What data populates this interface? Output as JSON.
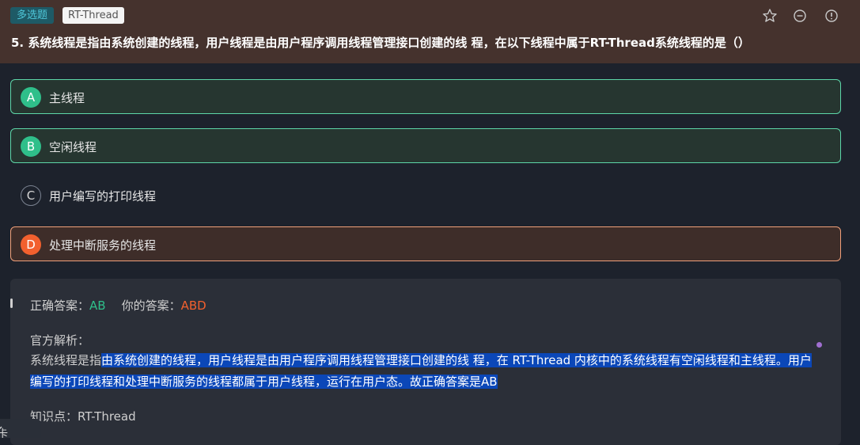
{
  "header": {
    "type_tag": "多选题",
    "topic_tag": "RT-Thread",
    "question": "5. 系统线程是指由系统创建的线程，用户线程是由用户程序调用线程管理接口创建的线 程，在以下线程中属于RT-Thread系统线程的是（）",
    "icons": [
      "star-icon",
      "minus-circle-icon",
      "info-icon"
    ]
  },
  "options": [
    {
      "letter": "A",
      "text": "主线程",
      "state": "correct"
    },
    {
      "letter": "B",
      "text": "空闲线程",
      "state": "correct"
    },
    {
      "letter": "C",
      "text": "用户编写的打印线程",
      "state": "plain"
    },
    {
      "letter": "D",
      "text": "处理中断服务的线程",
      "state": "wrong"
    }
  ],
  "result": {
    "correct_label": "正确答案：",
    "correct_value": "AB",
    "yours_label": "你的答案：",
    "yours_value": "ABD"
  },
  "explanation": {
    "title": "官方解析：",
    "prefix": "系统线程是指",
    "highlighted": "由系统创建的线程，用户线程是由用户程序调用线程管理接口创建的线 程，在 RT-Thread 内核中的系统线程有空闲线程和主线程。用户编写的打印线程和处理中断服务的线程都属于用户线程，运行在用户态。故正确答案是AB"
  },
  "knowledge": {
    "label": "知识点：",
    "value": "RT-Thread"
  },
  "answer_card": {
    "label": "题卡",
    "icon": "chevron-down-icon"
  },
  "colors": {
    "header_bg": "#45322d",
    "correct": "#2fbf8a",
    "wrong": "#f2602e",
    "highlight": "#0b47b8"
  }
}
